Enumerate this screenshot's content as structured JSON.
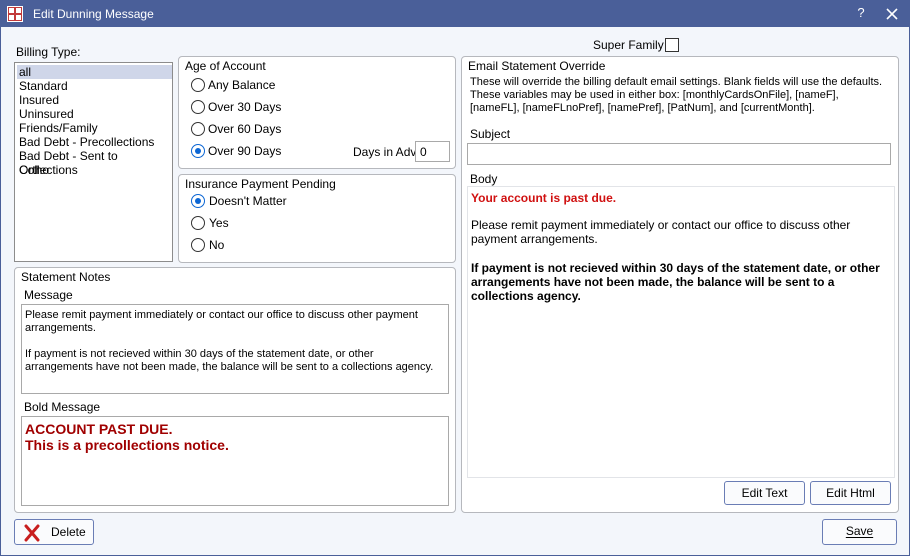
{
  "window": {
    "title": "Edit Dunning Message",
    "help_label": "?"
  },
  "billing_type": {
    "label": "Billing Type:",
    "items": [
      "all",
      "Standard",
      "Insured",
      "Uninsured",
      "Friends/Family",
      "Bad Debt - Precollections",
      "Bad Debt - Sent to Collections",
      "Ortho"
    ],
    "selected": "all"
  },
  "age_of_account": {
    "title": "Age of Account",
    "options": [
      "Any Balance",
      "Over 30 Days",
      "Over 60 Days",
      "Over 90 Days"
    ],
    "selected": "Over 90 Days",
    "days_in_adv_label": "Days in Adv",
    "days_in_adv_value": "0"
  },
  "insurance_payment_pending": {
    "title": "Insurance Payment Pending",
    "options": [
      "Doesn't Matter",
      "Yes",
      "No"
    ],
    "selected": "Doesn't Matter"
  },
  "super_family": {
    "label": "Super Family",
    "checked": false
  },
  "statement_notes": {
    "title": "Statement Notes",
    "message_label": "Message",
    "message_line1": "Please remit payment immediately or contact our office to discuss other payment arrangements.",
    "message_line2": "If payment is not recieved within 30 days of the statement date, or other arrangements have not been made, the balance will be sent to a collections agency.",
    "bold_message_label": "Bold Message",
    "bold_line1": "ACCOUNT PAST DUE.",
    "bold_line2": "This is a precollections notice."
  },
  "email_override": {
    "title": "Email Statement Override",
    "description": "These will override the billing default email settings.  Blank fields will use the defaults. These variables may be used in either box:  [monthlyCardsOnFile], [nameF], [nameFL], [nameFLnoPref],  [namePref], [PatNum], and [currentMonth].",
    "subject_label": "Subject",
    "subject_value": "",
    "body_label": "Body",
    "body_line1": "Your account is past due.",
    "body_line2": "Please remit payment immediately or contact our office to discuss other payment arrangements.",
    "body_line3": "If payment is not recieved within 30 days of the statement date, or other arrangements have not been made, the balance will be sent to a collections agency.",
    "edit_text_label": "Edit Text",
    "edit_html_label": "Edit Html"
  },
  "footer": {
    "delete_label": "Delete",
    "save_label": "Save"
  },
  "colors": {
    "titlebar": "#4a5f99",
    "accent_red": "#a00000",
    "radio_blue": "#0b66d4",
    "body_red": "#d01010"
  }
}
